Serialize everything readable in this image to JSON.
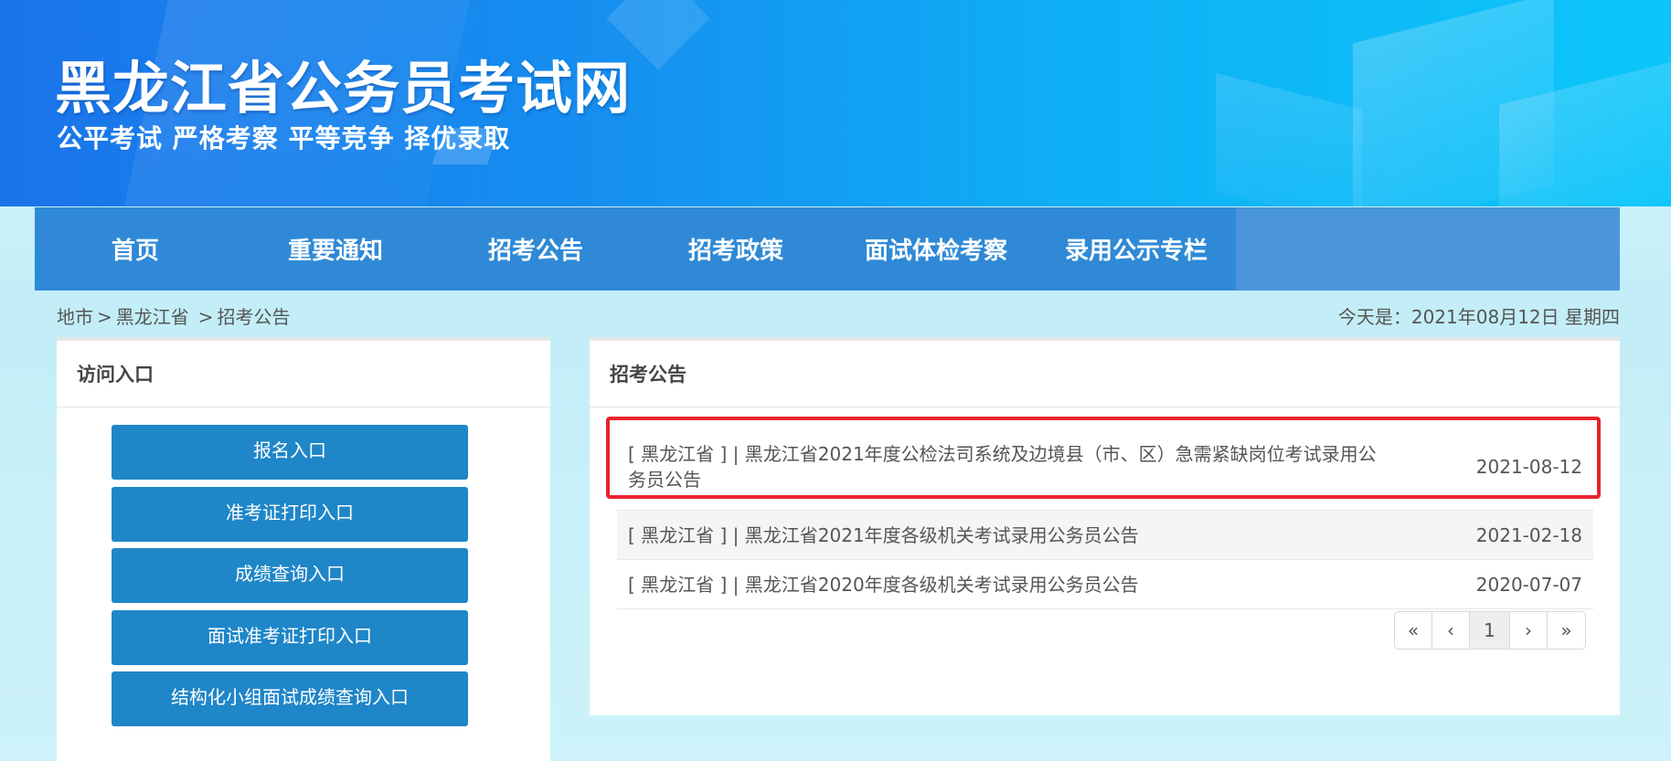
{
  "banner": {
    "title": "黑龙江省公务员考试网",
    "slogan": "公平考试 严格考察 平等竞争 择优录取"
  },
  "nav": {
    "items": [
      {
        "label": "首页"
      },
      {
        "label": "重要通知"
      },
      {
        "label": "招考公告"
      },
      {
        "label": "招考政策"
      },
      {
        "label": "面试体检考察"
      },
      {
        "label": "录用公示专栏"
      }
    ]
  },
  "breadcrumb": {
    "items": [
      "地市",
      "黑龙江省",
      "招考公告"
    ],
    "separator": ">"
  },
  "today": "今天是：2021年08月12日 星期四",
  "left_panel": {
    "title": "访问入口",
    "buttons": [
      {
        "label": "报名入口"
      },
      {
        "label": "准考证打印入口"
      },
      {
        "label": "成绩查询入口"
      },
      {
        "label": "面试准考证打印入口"
      },
      {
        "label": "结构化小组面试成绩查询入口"
      }
    ]
  },
  "right_panel": {
    "title": "招考公告",
    "rows": [
      {
        "title": "[ 黑龙江省 ] | 黑龙江省2021年度公检法司系统及边境县（市、区）急需紧缺岗位考试录用公务员公告",
        "date": "2021-08-12"
      },
      {
        "title": "[ 黑龙江省 ] | 黑龙江省2021年度各级机关考试录用公务员公告",
        "date": "2021-02-18"
      },
      {
        "title": "[ 黑龙江省 ] | 黑龙江省2020年度各级机关考试录用公务员公告",
        "date": "2020-07-07"
      }
    ]
  },
  "pager": {
    "first": "«",
    "prev": "‹",
    "current": "1",
    "next": "›",
    "last": "»"
  },
  "colors": {
    "nav_bg": "#2f89d6",
    "button_bg": "#1f86c8",
    "highlight_border": "#e8242a"
  }
}
